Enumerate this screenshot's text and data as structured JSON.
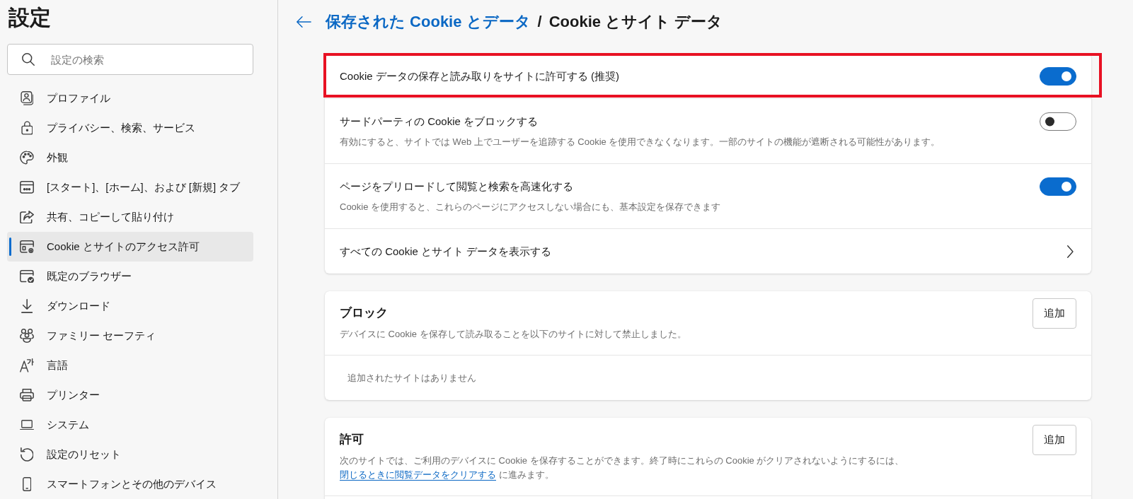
{
  "sidebar": {
    "title": "設定",
    "search": {
      "placeholder": "設定の検索"
    },
    "items": [
      {
        "label": "プロファイル",
        "selected": false
      },
      {
        "label": "プライバシー、検索、サービス",
        "selected": false
      },
      {
        "label": "外観",
        "selected": false
      },
      {
        "label": "[スタート]、[ホーム]、および [新規] タブ",
        "selected": false
      },
      {
        "label": "共有、コピーして貼り付け",
        "selected": false
      },
      {
        "label": "Cookie とサイトのアクセス許可",
        "selected": true
      },
      {
        "label": "既定のブラウザー",
        "selected": false
      },
      {
        "label": "ダウンロード",
        "selected": false
      },
      {
        "label": "ファミリー セーフティ",
        "selected": false
      },
      {
        "label": "言語",
        "selected": false
      },
      {
        "label": "プリンター",
        "selected": false
      },
      {
        "label": "システム",
        "selected": false
      },
      {
        "label": "設定のリセット",
        "selected": false
      },
      {
        "label": "スマートフォンとその他のデバイス",
        "selected": false
      }
    ]
  },
  "header": {
    "breadcrumb": "保存された Cookie とデータ",
    "separator": "/",
    "title": "Cookie とサイト データ"
  },
  "settings": {
    "rows": [
      {
        "kind": "toggle",
        "label": "Cookie データの保存と読み取りをサイトに許可する (推奨)",
        "on": true,
        "highlighted": true
      },
      {
        "kind": "toggle",
        "label": "サードパーティの Cookie をブロックする",
        "description": "有効にすると、サイトでは Web 上でユーザーを追跡する Cookie を使用できなくなります。一部のサイトの機能が遮断される可能性があります。",
        "on": false,
        "highlighted": false
      },
      {
        "kind": "toggle",
        "label": "ページをプリロードして閲覧と検索を高速化する",
        "description": "Cookie を使用すると、これらのページにアクセスしない場合にも、基本設定を保存できます",
        "on": true,
        "highlighted": false
      },
      {
        "kind": "link",
        "label": "すべての Cookie とサイト データを表示する",
        "highlighted": false
      }
    ]
  },
  "sections": [
    {
      "title": "ブロック",
      "description": "デバイスに Cookie を保存して読み取ることを以下のサイトに対して禁止しました。",
      "button": "追加",
      "empty_text": "追加されたサイトはありません"
    },
    {
      "title": "許可",
      "description": "次のサイトでは、ご利用のデバイスに Cookie を保存することができます。終了時にこれらの Cookie がクリアされないようにするには、",
      "link": "閉じるときに閲覧データをクリアする",
      "description_end": "に進みます。",
      "button": "追加"
    }
  ]
}
